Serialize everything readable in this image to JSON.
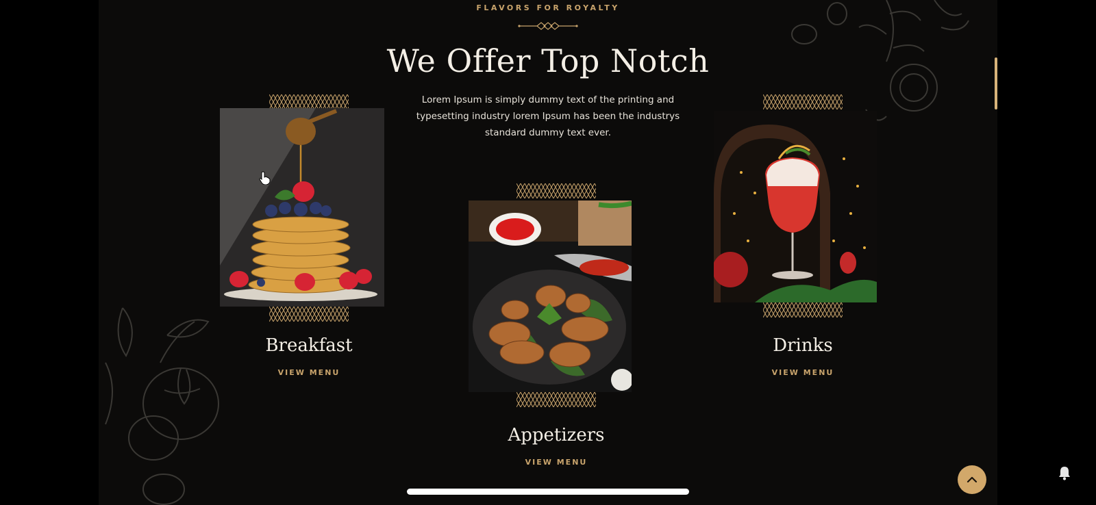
{
  "section": {
    "eyebrow": "FLAVORS FOR ROYALTY",
    "heading": "We Offer Top Notch",
    "intro": "Lorem Ipsum is simply dummy text of the printing and typesetting industry lorem Ipsum has been the industrys standard dummy text ever."
  },
  "cards": [
    {
      "title": "Breakfast",
      "link": "VIEW MENU",
      "photo": "pancakes-with-honey-and-berries"
    },
    {
      "title": "Appetizers",
      "link": "VIEW MENU",
      "photo": "grilled-chicken-wings"
    },
    {
      "title": "Drinks",
      "link": "VIEW MENU",
      "photo": "red-cocktail"
    }
  ],
  "colors": {
    "background": "#0c0b0a",
    "accent": "#c9a46c",
    "heading": "#f4efe6"
  },
  "icons": {
    "scroll_top": "chevron-up-icon",
    "notification": "bell-icon"
  }
}
